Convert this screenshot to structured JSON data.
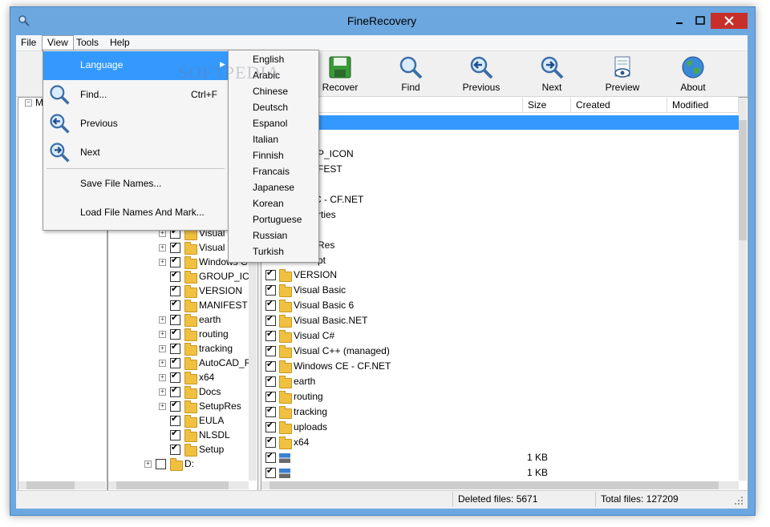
{
  "window": {
    "title": "FineRecovery"
  },
  "menubar": {
    "file": "File",
    "view": "View",
    "tools": "Tools",
    "help": "Help"
  },
  "toolbar": {
    "recover": "Recover",
    "find": "Find",
    "previous": "Previous",
    "next": "Next",
    "preview": "Preview",
    "about": "About"
  },
  "view_menu": {
    "language": "Language",
    "find": "Find...",
    "find_shortcut": "Ctrl+F",
    "previous": "Previous",
    "next": "Next",
    "save_file_names": "Save File Names...",
    "load_file_names": "Load File Names And Mark..."
  },
  "language_menu": [
    "English",
    "Arabic",
    "Chinese",
    "Deutsch",
    "Espanol",
    "Italian",
    "Finnish",
    "Francais",
    "Japanese",
    "Korean",
    "Portuguese",
    "Russian",
    "Turkish"
  ],
  "watermark": "SOFTPEDIA",
  "left_tree": {
    "root_label": "M"
  },
  "tree_items": [
    "Visual",
    "Visual",
    "Windows C",
    "GROUP_ICO",
    "VERSION",
    "MANIFEST",
    "earth",
    "routing",
    "tracking",
    "AutoCAD_R",
    "x64",
    "Docs",
    "SetupRes",
    "EULA",
    "NLSDL",
    "Setup",
    "D:"
  ],
  "list": {
    "columns": {
      "size": "Size",
      "created": "Created",
      "modified": "Modified"
    },
    "partial_rows": [
      "P_ICON",
      "FEST",
      "PC - CF.NET",
      "rties",
      "Res",
      "pt"
    ],
    "rows": [
      {
        "name": "VERSION",
        "size": ""
      },
      {
        "name": "Visual Basic",
        "size": ""
      },
      {
        "name": "Visual Basic 6",
        "size": ""
      },
      {
        "name": "Visual Basic.NET",
        "size": ""
      },
      {
        "name": "Visual C#",
        "size": ""
      },
      {
        "name": "Visual C++ (managed)",
        "size": ""
      },
      {
        "name": "Windows CE - CF.NET",
        "size": ""
      },
      {
        "name": "earth",
        "size": ""
      },
      {
        "name": "routing",
        "size": ""
      },
      {
        "name": "tracking",
        "size": ""
      },
      {
        "name": "uploads",
        "size": ""
      },
      {
        "name": "x64",
        "size": ""
      },
      {
        "name": "",
        "size": "1 KB"
      },
      {
        "name": "",
        "size": "1 KB"
      }
    ]
  },
  "status": {
    "deleted": "Deleted files: 5671",
    "total": "Total files: 127209"
  }
}
